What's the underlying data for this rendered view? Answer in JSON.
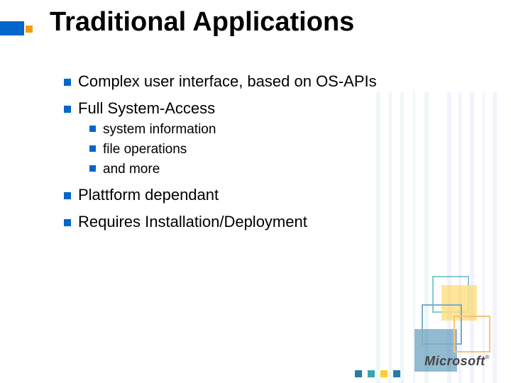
{
  "title": "Traditional Applications",
  "bullets": {
    "b0": "Complex user interface, based on OS-APIs",
    "b1": "Full System-Access",
    "b1_0": "system information",
    "b1_1": "file operations",
    "b1_2": "and more",
    "b2": "Plattform dependant",
    "b3": "Requires Installation/Deployment"
  },
  "logo": "Microsoft"
}
